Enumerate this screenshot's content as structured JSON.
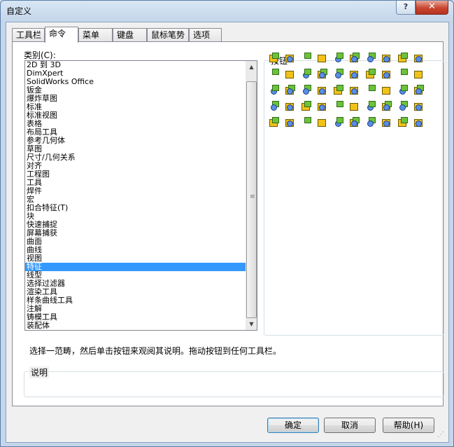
{
  "window": {
    "title": "自定义",
    "help_glyph": "?",
    "close_glyph": "✕"
  },
  "tabs": [
    {
      "label": "工具栏"
    },
    {
      "label": "命令"
    },
    {
      "label": "菜单"
    },
    {
      "label": "键盘"
    },
    {
      "label": "鼠标笔势"
    },
    {
      "label": "选项"
    }
  ],
  "active_tab": "命令",
  "categories": {
    "label": "类别(C):",
    "selected": "特征",
    "items": [
      "2D 到 3D",
      "DimXpert",
      "SolidWorks Office",
      "钣金",
      "爆炸草图",
      "标准",
      "标准视图",
      "表格",
      "布局工具",
      "参考几何体",
      "草图",
      "尺寸/几何关系",
      "对齐",
      "工程图",
      "工具",
      "焊件",
      "宏",
      "扣合特征(T)",
      "块",
      "快速捕捉",
      "屏幕捕获",
      "曲面",
      "曲线",
      "视图",
      "特征",
      "线型",
      "选择过滤器",
      "渲染工具",
      "样条曲线工具",
      "注解",
      "铸模工具",
      "装配体"
    ]
  },
  "buttons_group": {
    "label": "按钮",
    "icon_names": [
      "extruded-boss-icon",
      "revolved-boss-icon",
      "swept-boss-icon",
      "lofted-boss-icon",
      "boundary-boss-icon",
      "extruded-cut-icon",
      "revolved-cut-icon",
      "swept-cut-icon",
      "lofted-cut-icon",
      "boundary-cut-icon",
      "fillet-icon",
      "chamfer-icon",
      "rib-icon",
      "shell-icon",
      "draft-icon",
      "hole-wizard-icon",
      "dome-icon",
      "flex-icon",
      "wrap-icon",
      "split-icon",
      "linear-pattern-icon",
      "circular-pattern-icon",
      "mirror-icon",
      "curve-pattern-icon",
      "sketch-pattern-icon",
      "table-pattern-icon",
      "fill-pattern-icon",
      "combine-icon",
      "intersect-icon",
      "thicken-icon",
      "move-face-icon",
      "delete-body-icon",
      "scale-icon",
      "freeform-icon",
      "indent-icon",
      "deform-icon",
      "cavity-icon",
      "imported-icon",
      "hole-series-icon",
      "sweep-path-icon",
      "reference-icon",
      "plane-icon",
      "axis-icon",
      "coordinate-icon",
      "point-icon",
      "mate-reference-icon",
      "feature-works-icon",
      "instant3d-icon",
      "live-section-icon",
      "grid-table-icon"
    ]
  },
  "hint_text": "选择一范畴，然后单击按钮来观阅其说明。拖动按钮到任何工具栏。",
  "description": {
    "label": "说明",
    "text": ""
  },
  "footer": {
    "ok": "确定",
    "cancel": "取消",
    "help": "帮助(H)"
  },
  "colors": {
    "selection": "#3399ff",
    "icon_yellow": "#f2c21a",
    "icon_green": "#6cc23a",
    "close_red": "#c8452f"
  }
}
